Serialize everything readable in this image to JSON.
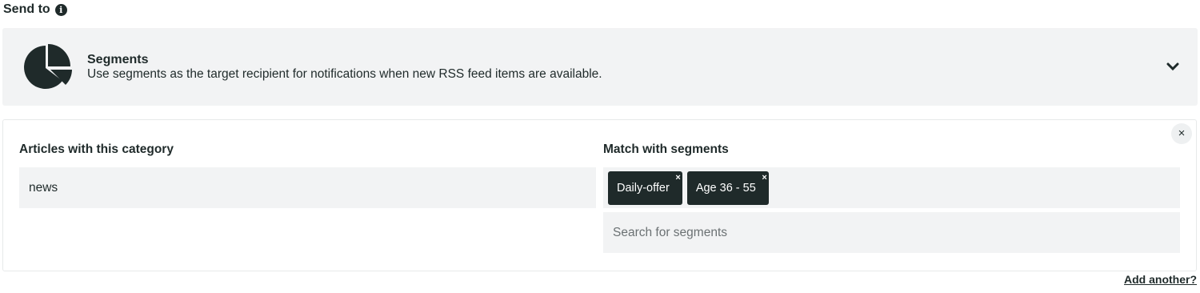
{
  "header": {
    "title": "Send to",
    "info_icon": "info-icon",
    "info_glyph": "i"
  },
  "segments_card": {
    "icon": "pie-chart-icon",
    "title": "Segments",
    "description": "Use segments as the target recipient for notifications when new RSS feed items are available.",
    "toggle_icon": "chevron-down-icon"
  },
  "panel": {
    "close_glyph": "×",
    "category_label": "Articles with this category",
    "category_value": "news",
    "segments_label": "Match with segments",
    "selected_segments": [
      "Daily-offer",
      "Age 36 - 55"
    ],
    "tag_remove_glyph": "×",
    "search_placeholder": "Search for segments"
  },
  "footer": {
    "add_another_label": "Add another?"
  },
  "colors": {
    "dark": "#1f2a2a",
    "field_bg": "#f2f3f4",
    "card_bg": "#f2f3f4"
  }
}
